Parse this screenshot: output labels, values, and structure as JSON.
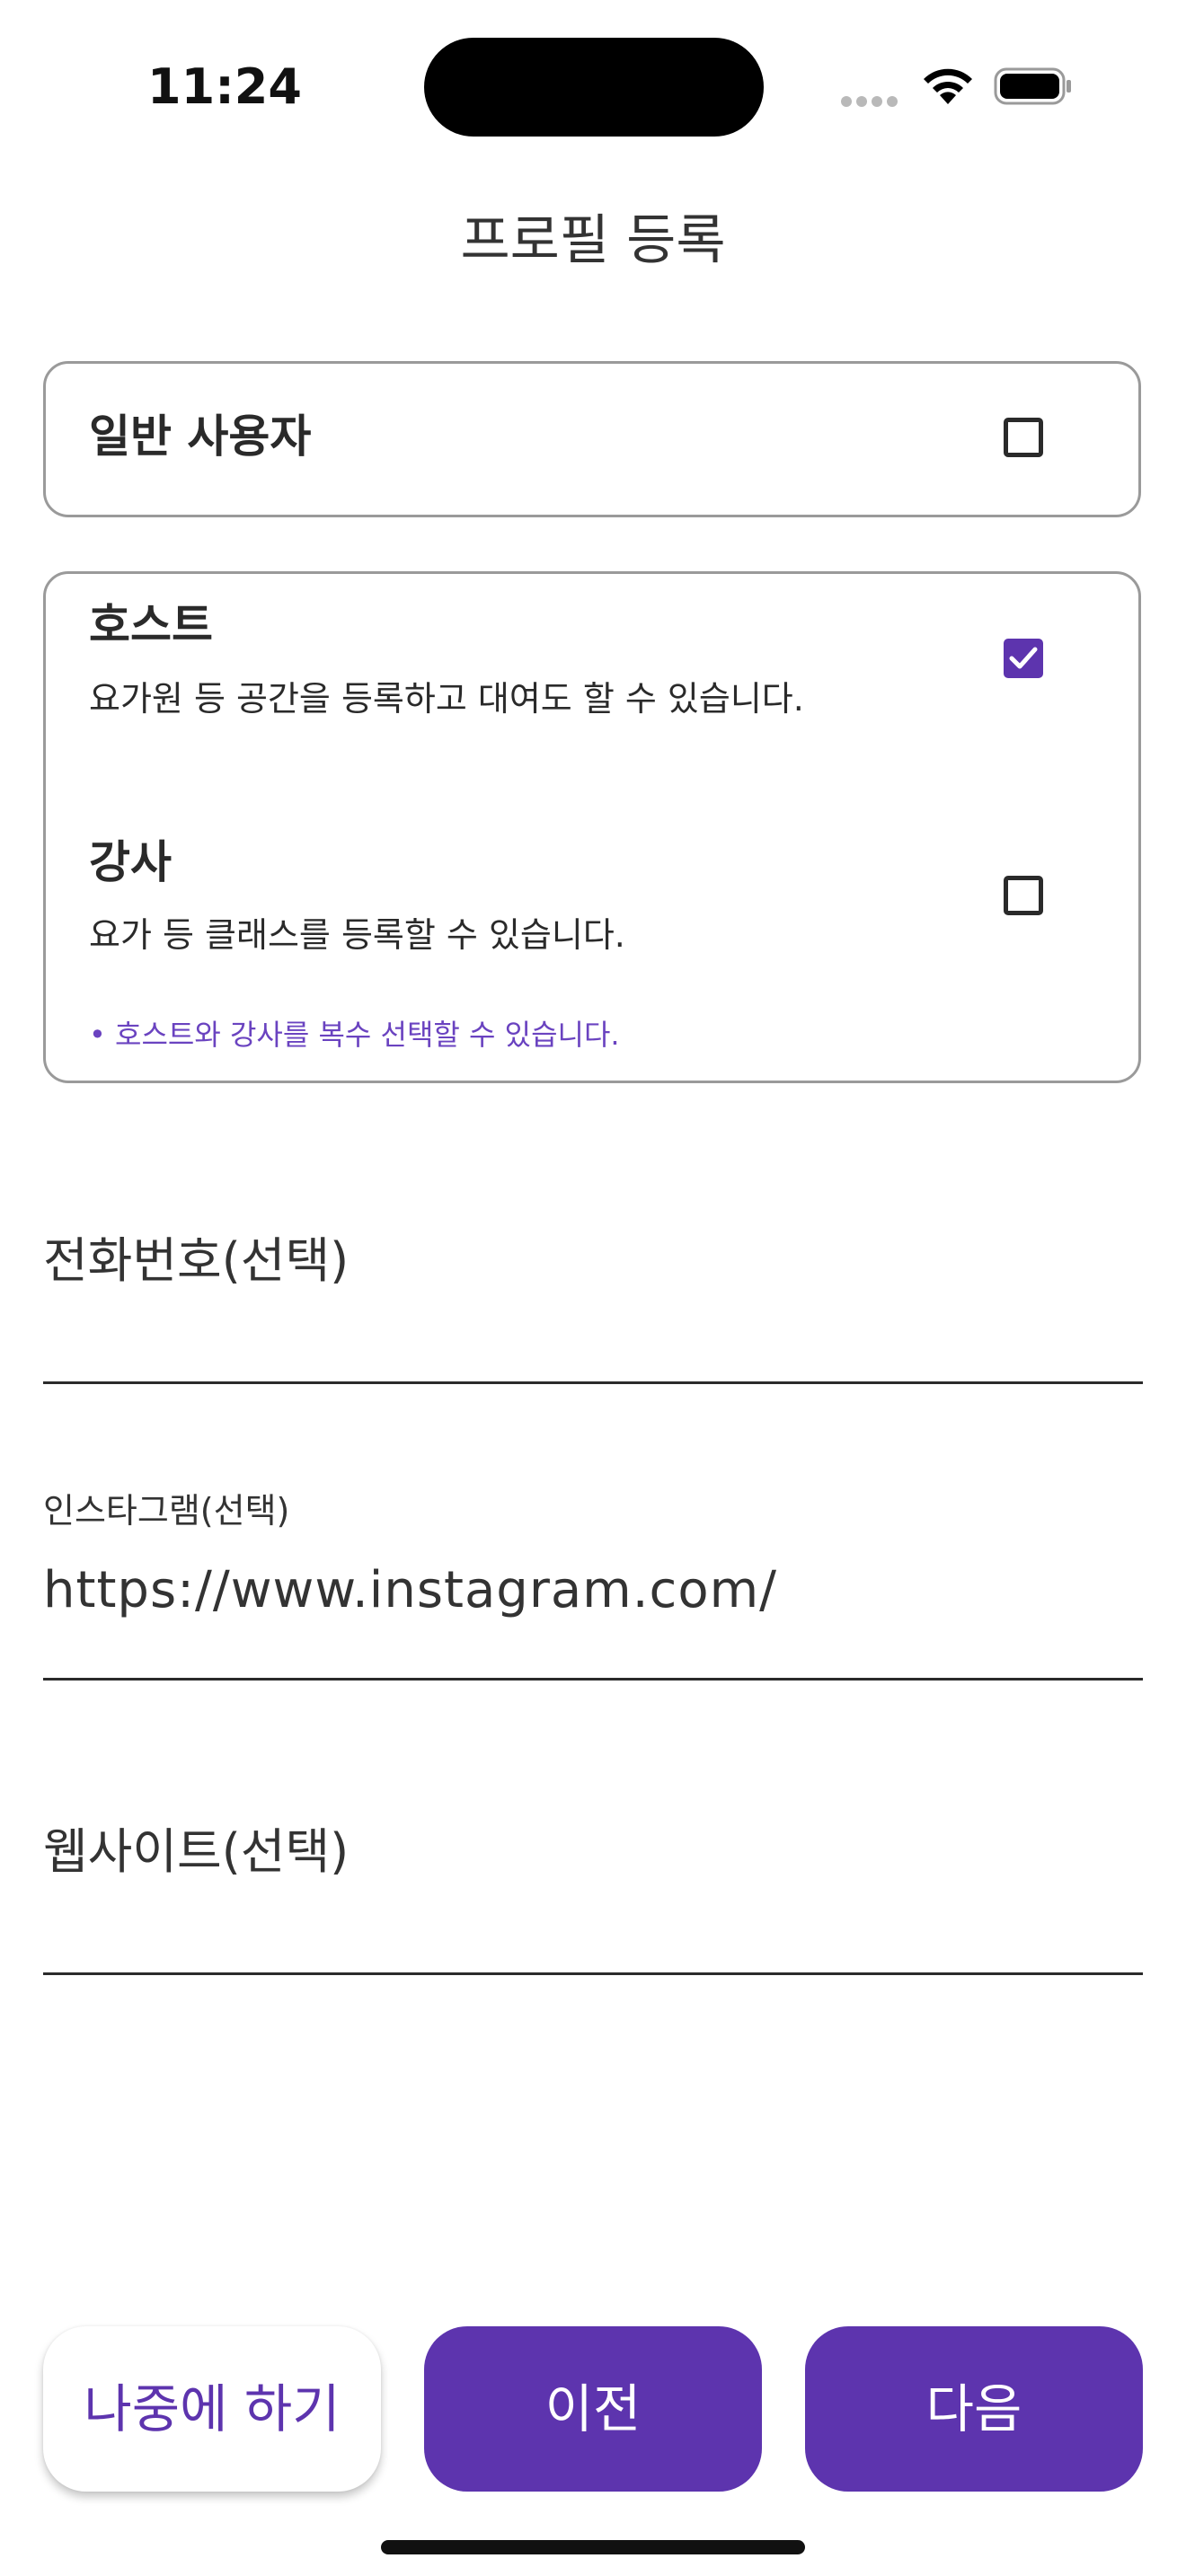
{
  "status_bar": {
    "time": "11:24"
  },
  "header": {
    "title": "프로필 등록"
  },
  "options": {
    "general": {
      "label": "일반 사용자",
      "checked": false
    },
    "host": {
      "label": "호스트",
      "description": "요가원 등 공간을 등록하고 대여도 할 수 있습니다.",
      "checked": true
    },
    "instructor": {
      "label": "강사",
      "description": "요가 등 클래스를 등록할 수 있습니다.",
      "checked": false
    },
    "note": "• 호스트와 강사를 복수 선택할 수 있습니다."
  },
  "fields": {
    "phone": {
      "label": "전화번호(선택)",
      "value": ""
    },
    "instagram": {
      "label": "인스타그램(선택)",
      "value": "https://www.instagram.com/"
    },
    "website": {
      "label": "웹사이트(선택)",
      "value": ""
    }
  },
  "buttons": {
    "later": "나중에 하기",
    "previous": "이전",
    "next": "다음"
  },
  "colors": {
    "accent": "#5d34ae",
    "note": "#6a43c0"
  },
  "icons": {
    "wifi": "wifi-icon",
    "battery": "battery-icon",
    "cellular": "cellular-signal-icon",
    "check": "checkmark-icon"
  }
}
